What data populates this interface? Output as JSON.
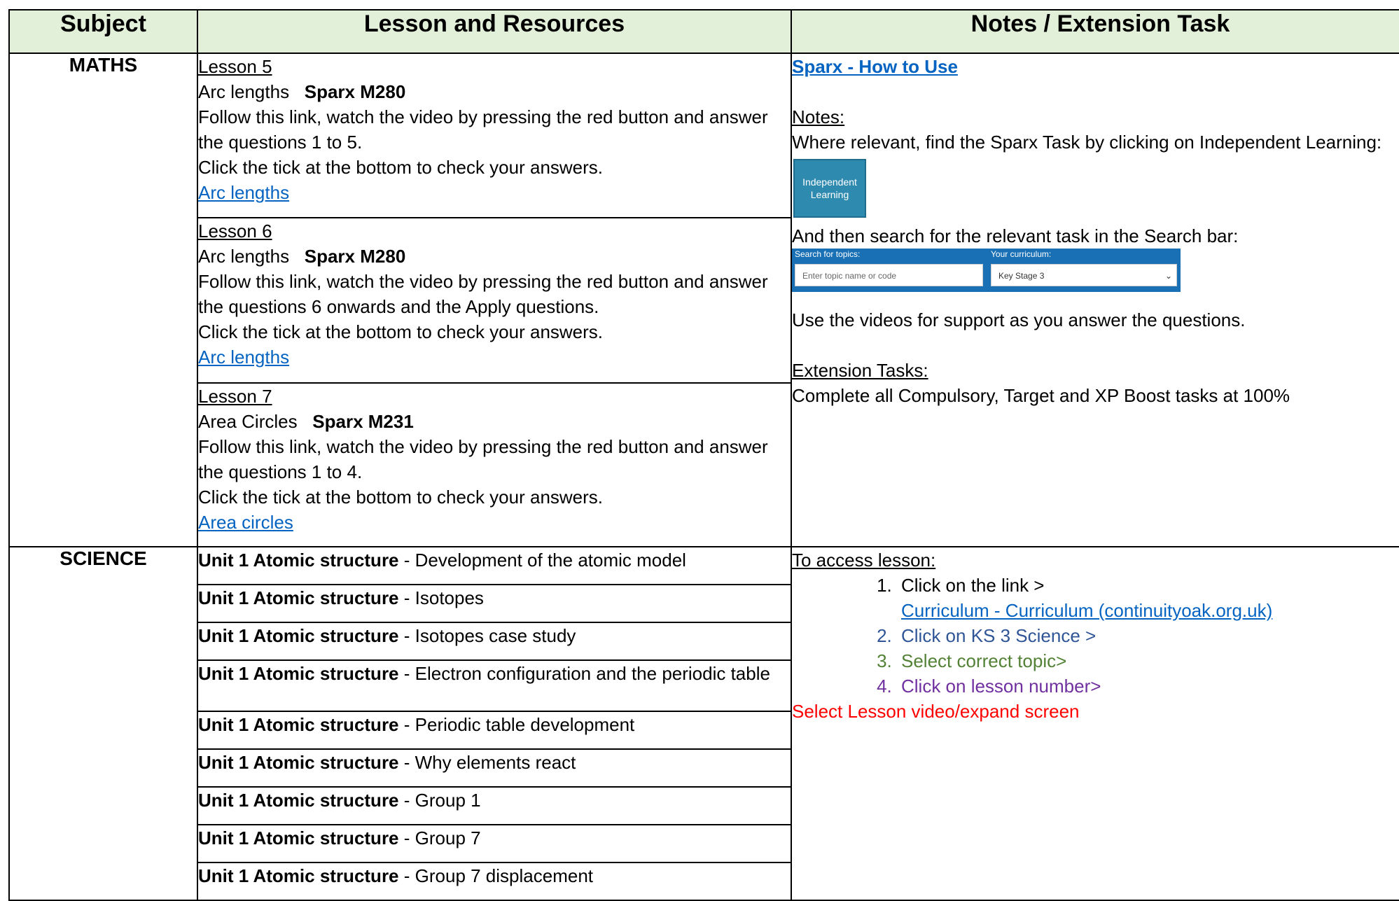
{
  "header": {
    "subject": "Subject",
    "lesson": "Lesson and Resources",
    "notes": "Notes / Extension Task"
  },
  "maths": {
    "subject": "MATHS",
    "lessons": [
      {
        "title": "Lesson 5",
        "topic": "Arc lengths",
        "code": "Sparx M280",
        "instr1": "Follow this link, watch the video by pressing the red button and answer the questions 1 to 5.",
        "instr2": "Click the tick at the bottom to check your answers.",
        "link": "Arc lengths"
      },
      {
        "title": "Lesson 6",
        "topic": "Arc lengths",
        "code": "Sparx M280",
        "instr1": "Follow this link, watch the video by pressing the red button and answer the questions 6 onwards and the Apply questions.",
        "instr2": "Click the tick at the bottom to check your answers.",
        "link": "Arc lengths"
      },
      {
        "title": "Lesson 7",
        "topic": "Area Circles",
        "code": "Sparx M231",
        "instr1": "Follow this link, watch the video by pressing the red button and answer the questions 1 to 4.",
        "instr2": "Click the tick at the bottom to check your answers.",
        "link": "Area circles"
      }
    ],
    "notes": {
      "howto_link": "Sparx - How to Use",
      "notes_heading": "Notes:",
      "notes_text": "Where relevant, find the Sparx Task by clicking on Independent Learning:",
      "badge_text": "Independent Learning",
      "search_text": "And then search for the relevant task in the Search bar:",
      "search_label_topics": "Search for topics:",
      "search_placeholder": "Enter topic name or code",
      "search_label_curriculum": "Your curriculum:",
      "search_curriculum_value": "Key Stage 3",
      "video_text": "Use the videos for support as you answer the questions.",
      "extension_heading": "Extension Tasks:",
      "extension_text": "Complete all Compulsory, Target and XP Boost tasks at 100%"
    }
  },
  "science": {
    "subject": "SCIENCE",
    "unit_label": "Unit 1 Atomic structure",
    "lessons": [
      " - Development of the atomic model",
      " - Isotopes",
      " - Isotopes case study",
      " - Electron configuration and the periodic table",
      " - Periodic table development",
      " - Why elements react",
      " - Group 1",
      " - Group 7",
      " - Group 7 displacement"
    ],
    "notes": {
      "access_heading": "To access lesson:",
      "step1": "Click on the link >",
      "step1_link": "Curriculum - Curriculum (continuityoak.org.uk)",
      "step2": "Click on KS 3 Science >",
      "step3": "Select correct topic>",
      "step4": "Click on lesson number>",
      "final": "Select Lesson video/expand screen"
    }
  },
  "colors": {
    "header_bg": "#e2efd9",
    "link": "#0563c1",
    "step2": "#2f5597",
    "step3": "#538135",
    "step4": "#7030a0",
    "final": "#ff0000"
  }
}
